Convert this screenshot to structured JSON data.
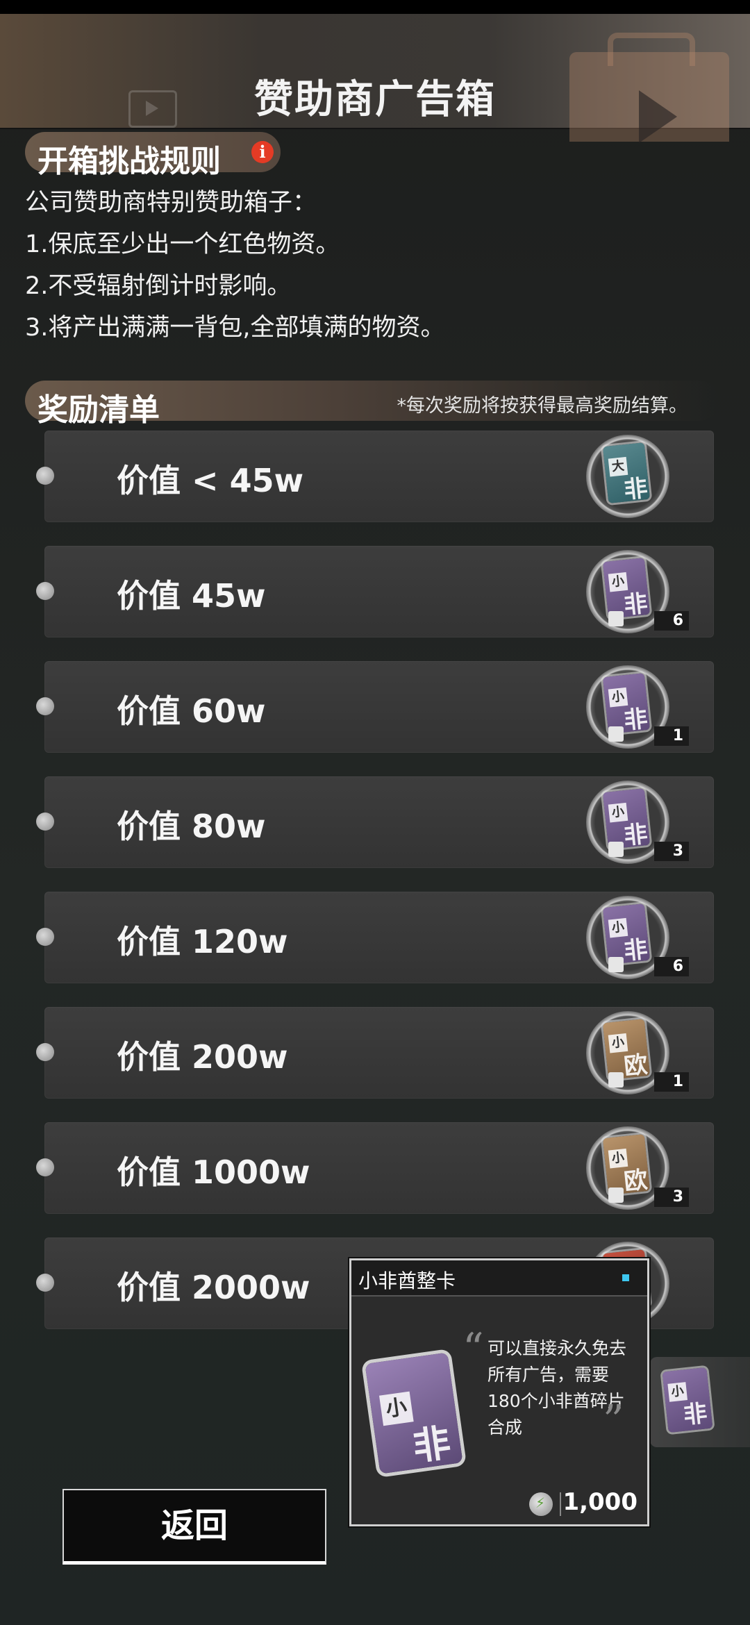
{
  "header": {
    "title": "赞助商广告箱"
  },
  "rules": {
    "title": "开箱挑战规则",
    "info_icon_label": "i",
    "lines": [
      "公司赞助商特别赞助箱子：",
      "1.保底至少出一个红色物资。",
      "2.不受辐射倒计时影响。",
      "3.将产出满满一背包,全部填满的物资。"
    ]
  },
  "rewards": {
    "title": "奖励清单",
    "note": "*每次奖励将按获得最高奖励结算。",
    "items": [
      {
        "label": "价值 < 45w",
        "card": "teal",
        "c1": "大",
        "c2": "非",
        "count": ""
      },
      {
        "label": "价值 45w",
        "card": "purple",
        "c1": "小",
        "c2": "非",
        "count": "6"
      },
      {
        "label": "价值 60w",
        "card": "purple",
        "c1": "小",
        "c2": "非",
        "count": "1"
      },
      {
        "label": "价值 80w",
        "card": "purple",
        "c1": "小",
        "c2": "非",
        "count": "3"
      },
      {
        "label": "价值 120w",
        "card": "purple",
        "c1": "小",
        "c2": "非",
        "count": "6"
      },
      {
        "label": "价值 200w",
        "card": "gold",
        "c1": "小",
        "c2": "欧",
        "count": "1"
      },
      {
        "label": "价值 1000w",
        "card": "gold",
        "c1": "小",
        "c2": "欧",
        "count": "3"
      },
      {
        "label": "价值 2000w",
        "card": "red",
        "c1": "",
        "c2": "",
        "count": ""
      }
    ]
  },
  "popup": {
    "title": "小非酋整卡",
    "card_c1": "小",
    "card_c2": "非",
    "description": "可以直接永久免去所有广告，需要180个小非酋碎片合成",
    "price": "1,000",
    "quote_open": "“",
    "quote_close": "”"
  },
  "side_item": {
    "c1": "小",
    "c2": "非"
  },
  "back_button": {
    "label": "返回"
  },
  "colors": {
    "accent_red": "#e43b25",
    "popup_dot": "#3ec7f0"
  }
}
